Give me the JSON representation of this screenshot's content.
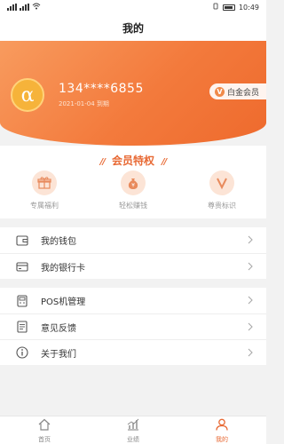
{
  "status_bar": {
    "time": "10:49"
  },
  "page": {
    "title": "我的"
  },
  "profile": {
    "avatar_glyph": "α",
    "phone": "134****6855",
    "expire": "2021-01-04 到期",
    "vip_badge": "白金会员"
  },
  "privileges": {
    "title": "会员特权",
    "items": [
      {
        "label": "专属福利",
        "icon": "gift-icon"
      },
      {
        "label": "轻松赚钱",
        "icon": "money-bag-icon"
      },
      {
        "label": "尊贵标识",
        "icon": "vip-mark-icon"
      }
    ]
  },
  "menu": {
    "group1": [
      {
        "label": "我的钱包",
        "icon": "wallet-icon"
      },
      {
        "label": "我的银行卡",
        "icon": "bank-card-icon"
      }
    ],
    "group2": [
      {
        "label": "POS机管理",
        "icon": "pos-icon"
      },
      {
        "label": "意见反馈",
        "icon": "feedback-icon"
      },
      {
        "label": "关于我们",
        "icon": "info-icon"
      }
    ]
  },
  "tabbar": {
    "items": [
      {
        "label": "首页",
        "icon": "home-icon"
      },
      {
        "label": "业绩",
        "icon": "chart-icon"
      },
      {
        "label": "我的",
        "icon": "user-icon",
        "active": true
      }
    ]
  },
  "colors": {
    "accent": "#f37a3c",
    "accent_light": "#fce4d6"
  }
}
